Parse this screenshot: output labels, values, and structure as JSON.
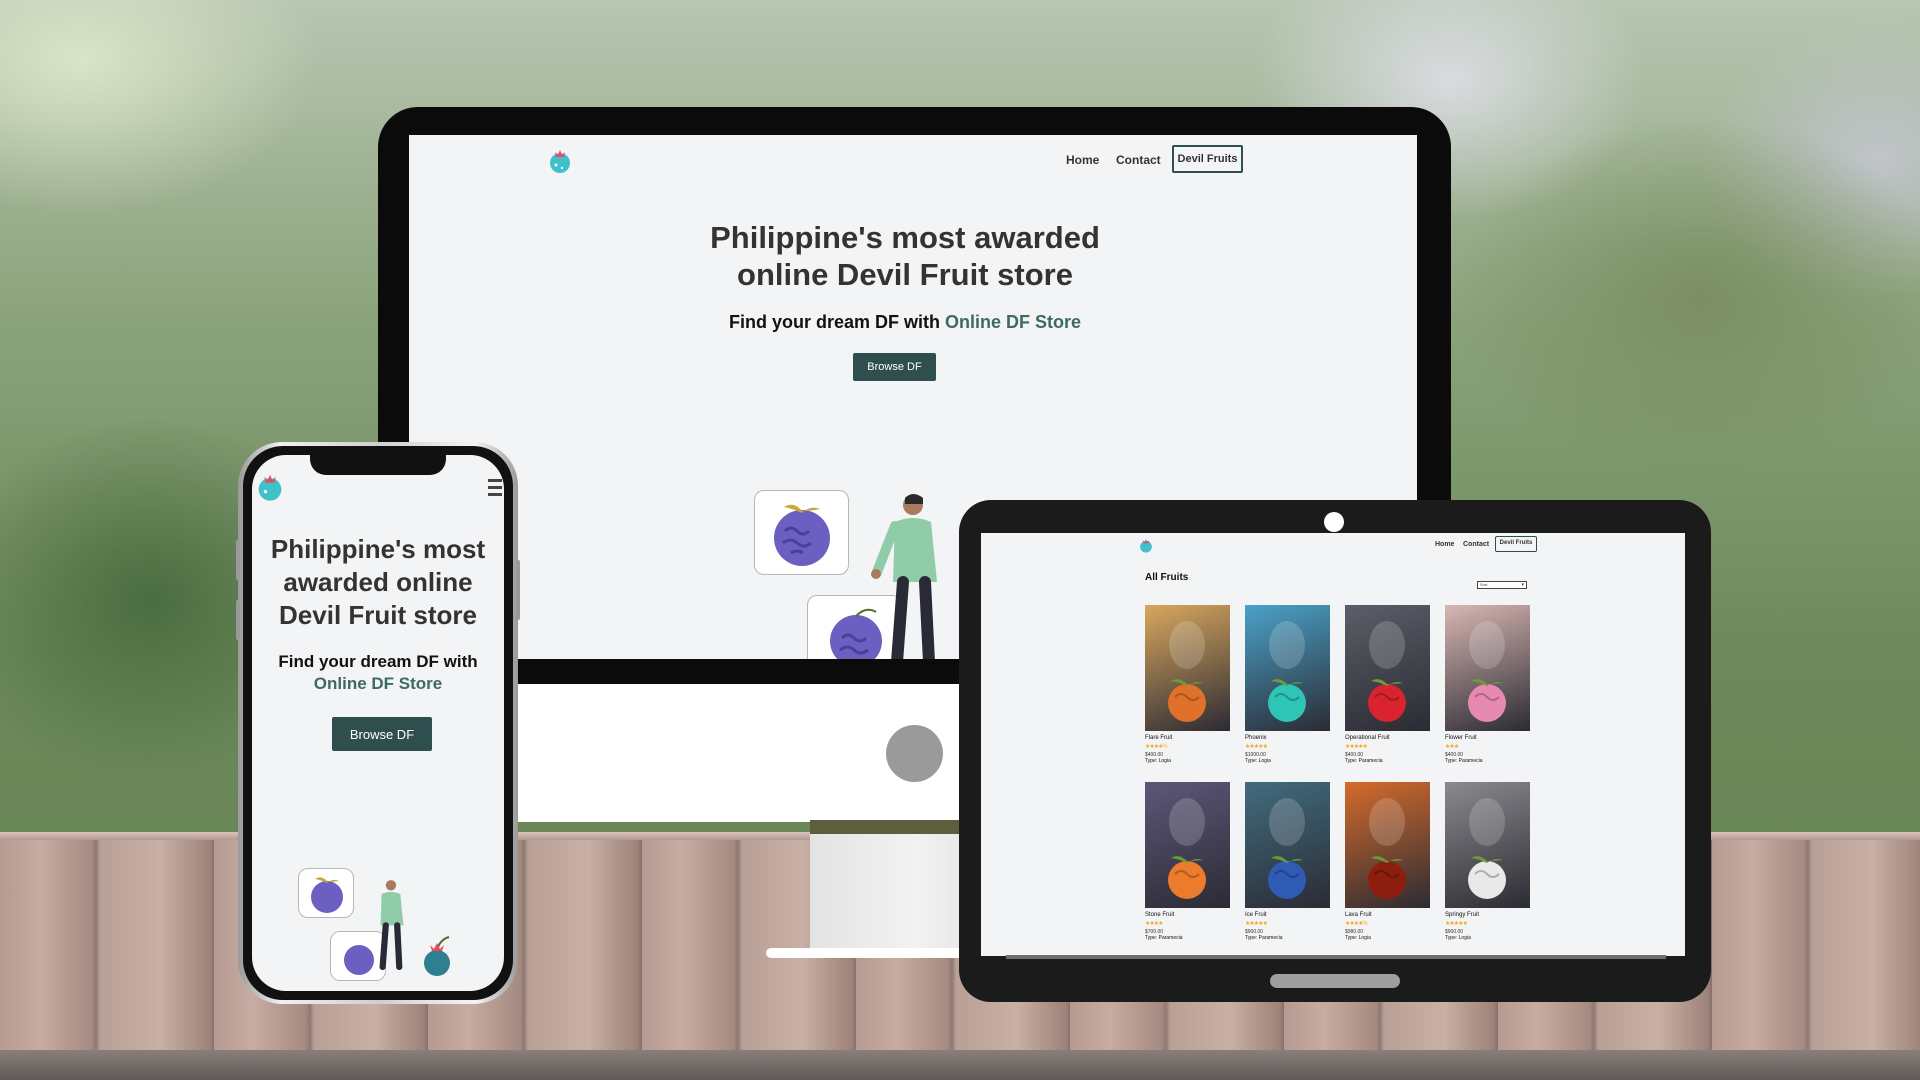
{
  "site": {
    "nav": {
      "home": "Home",
      "contact": "Contact",
      "devil_fruits": "Devil Fruits"
    },
    "hero": {
      "title_line1": "Philippine's most awarded",
      "title_line2": "online Devil Fruit store",
      "sub_prefix": "Find your dream DF with ",
      "sub_accent": "Online DF Store",
      "cta": "Browse DF"
    },
    "phone_hero": {
      "title_line1": "Philippine's most",
      "title_line2": "awarded online",
      "title_line3": "Devil Fruit store",
      "sub_line1": "Find your dream DF with",
      "sub_line2": "Online DF Store",
      "cta": "Browse DF"
    }
  },
  "tablet": {
    "section_title": "All Fruits",
    "sort_select": "Sort",
    "fruits": [
      {
        "name": "Flare Fruit",
        "stars": "★★★★½",
        "price": "$400.00",
        "type": "Type: Logia",
        "bg": "#d9a75e",
        "fruit": "#e0712b"
      },
      {
        "name": "Phoenix",
        "stars": "★★★★★",
        "price": "$1000.00",
        "type": "Type: Logia",
        "bg": "#4aa2c9",
        "fruit": "#2ec4b6"
      },
      {
        "name": "Operational Fruit",
        "stars": "★★★★★",
        "price": "$400.00",
        "type": "Type: Paramecia",
        "bg": "#5b5e68",
        "fruit": "#d9232e"
      },
      {
        "name": "Flower Fruit",
        "stars": "★★★",
        "price": "$400.00",
        "type": "Type: Paramecia",
        "bg": "#d8b7b3",
        "fruit": "#e78ab1"
      },
      {
        "name": "Stone Fruit",
        "stars": "★★★★",
        "price": "$700.00",
        "type": "Type: Paramecia",
        "bg": "#5c5779",
        "fruit": "#ed7b2e"
      },
      {
        "name": "Ice Fruit",
        "stars": "★★★★★",
        "price": "$900.00",
        "type": "Type: Paramecia",
        "bg": "#416c7f",
        "fruit": "#2f5bb5"
      },
      {
        "name": "Lava Fruit",
        "stars": "★★★★½",
        "price": "$980.00",
        "type": "Type: Logia",
        "bg": "#d56b2c",
        "fruit": "#8c1d0f"
      },
      {
        "name": "Springy Fruit",
        "stars": "★★★★★",
        "price": "$900.00",
        "type": "Type: Logia",
        "bg": "#8c8a8f",
        "fruit": "#e9e9e9"
      }
    ]
  },
  "colors": {
    "brand_dark": "#2f4f4f",
    "accent": "#3d6b5e",
    "logo": "#3fc1c9",
    "logo_crown": "#e84a5f"
  }
}
